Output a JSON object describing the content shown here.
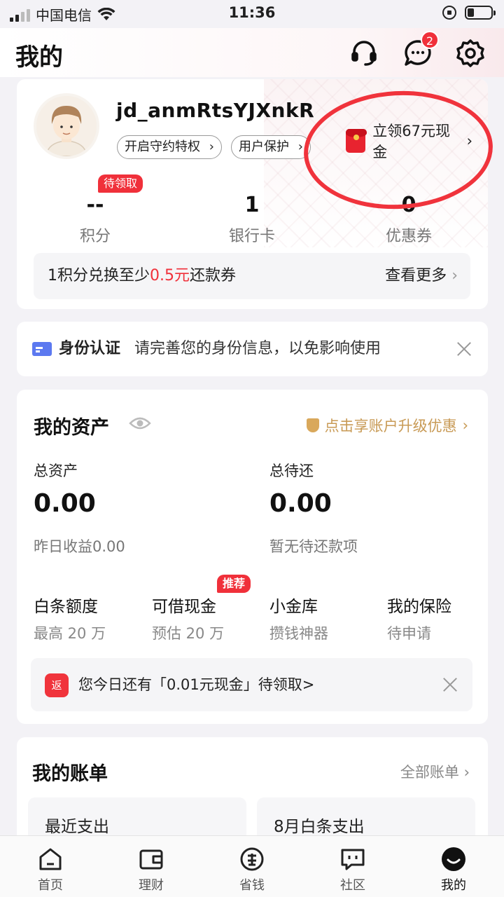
{
  "status_bar": {
    "carrier": "中国电信",
    "time": "11:36"
  },
  "header": {
    "title": "我的",
    "message_badge": "2"
  },
  "user": {
    "username": "jd_anmRtsYJXnkR",
    "chips": [
      "开启守约特权",
      "用户保护"
    ],
    "cash_offer": "立领67元现金",
    "stats": [
      {
        "value": "--",
        "label": "积分"
      },
      {
        "value": "1",
        "label": "银行卡"
      },
      {
        "value": "0",
        "label": "优惠券"
      }
    ],
    "pending_tag": "待领取",
    "exchange": {
      "prefix": "1积分兑换至少",
      "amount": "0.5元",
      "suffix": "还款券",
      "more": "查看更多"
    }
  },
  "identity": {
    "title": "身份认证",
    "desc": "请完善您的身份信息，以免影响使用"
  },
  "assets": {
    "title": "我的资产",
    "upgrade": "点击享账户升级优惠",
    "total_label": "总资产",
    "total_value": "0.00",
    "total_sub": "昨日收益0.00",
    "due_label": "总待还",
    "due_value": "0.00",
    "due_sub": "暂无待还款项",
    "services": [
      {
        "title": "白条额度",
        "sub": "最高 20 万"
      },
      {
        "title": "可借现金",
        "sub": "预估 20 万"
      },
      {
        "title": "小金库",
        "sub": "攒钱神器"
      },
      {
        "title": "我的保险",
        "sub": "待申请"
      }
    ],
    "recommend_tag": "推荐",
    "reward_icon": "返",
    "reward_text": "您今日还有「0.01元现金」待领取>"
  },
  "bills": {
    "title": "我的账单",
    "all": "全部账单",
    "boxes": [
      "最近支出",
      "8月白条支出"
    ]
  },
  "tabs": [
    {
      "label": "首页",
      "icon": "home-icon"
    },
    {
      "label": "理财",
      "icon": "wallet-icon"
    },
    {
      "label": "省钱",
      "icon": "save-money-icon"
    },
    {
      "label": "社区",
      "icon": "community-icon"
    },
    {
      "label": "我的",
      "icon": "profile-icon"
    }
  ],
  "colors": {
    "accent_red": "#f0303a",
    "gold": "#c89a55",
    "id_blue": "#5c79f0"
  }
}
